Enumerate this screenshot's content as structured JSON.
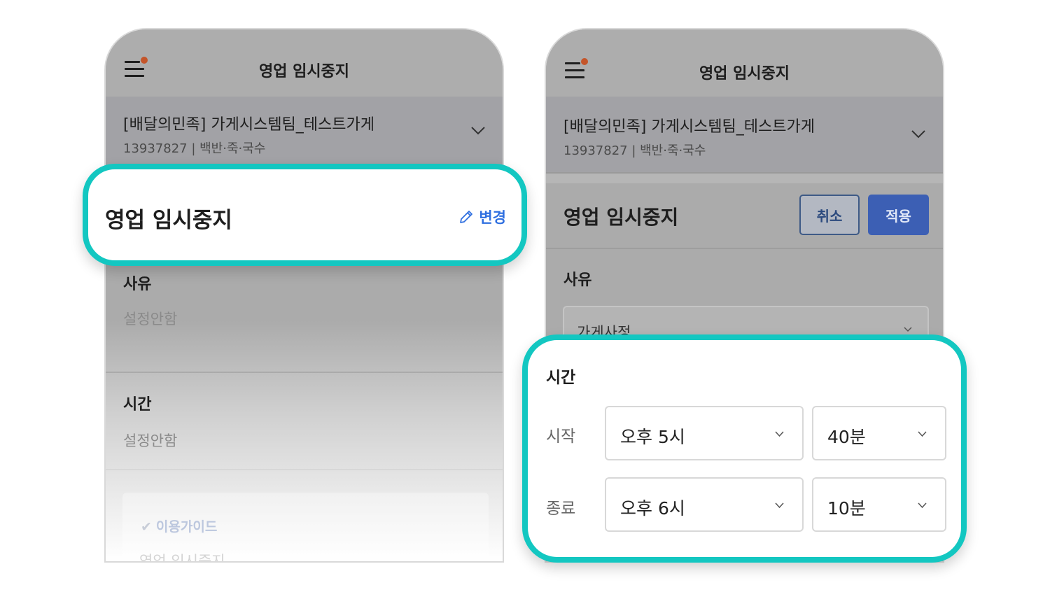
{
  "left_screen": {
    "header_title": "영업 임시중지",
    "store": {
      "name": "[배달의민족] 가게시스템팀_테스트가게",
      "meta": "13937827 | 백반·죽·국수"
    },
    "section_title": "영업 임시중지",
    "edit_label": "변경",
    "reason": {
      "label": "사유",
      "value": "설정안함"
    },
    "time": {
      "label": "시간",
      "value": "설정안함"
    },
    "guide": {
      "title": "이용가이드",
      "subtitle": "영업 임시중지"
    }
  },
  "right_screen": {
    "header_title": "영업 임시중지",
    "store": {
      "name": "[배달의민족] 가게시스템팀_테스트가게",
      "meta": "13937827 | 백반·죽·국수"
    },
    "section_title": "영업 임시중지",
    "cancel_label": "취소",
    "apply_label": "적용",
    "reason": {
      "label": "사유",
      "selected": "가게사정"
    },
    "time": {
      "label": "시간",
      "start": {
        "label": "시작",
        "hour": "오후 5시",
        "minute": "40분"
      },
      "end": {
        "label": "종료",
        "hour": "오후 6시",
        "minute": "10분"
      }
    }
  },
  "colors": {
    "highlight": "#13c7c1",
    "primary": "#3c5fb4",
    "link": "#2f6fe0",
    "notification_dot": "#c4552a"
  },
  "icons": [
    "menu-icon",
    "chevron-down-icon",
    "pencil-icon",
    "check-icon"
  ]
}
